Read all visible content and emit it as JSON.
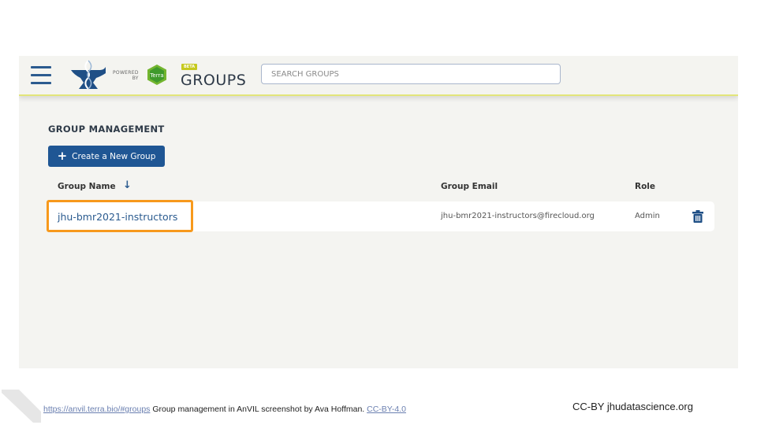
{
  "header": {
    "powered_by_line1": "POWERED",
    "powered_by_line2": "BY",
    "terra_label": "Terra",
    "beta_badge": "BETA",
    "title": "GROUPS",
    "search_placeholder": "SEARCH GROUPS",
    "search_value": ""
  },
  "main": {
    "section_title": "GROUP MANAGEMENT",
    "create_button_label": "Create a New Group",
    "columns": {
      "name": "Group Name",
      "email": "Group Email",
      "role": "Role"
    },
    "sort_direction": "descending",
    "rows": [
      {
        "name": "jhu-bmr2021-instructors",
        "email": "jhu-bmr2021-instructors@firecloud.org",
        "role": "Admin"
      }
    ]
  },
  "footer": {
    "link_url_text": "https://anvil.terra.bio/#groups",
    "caption": " Group management in AnVIL screenshot by Ava Hoffman. ",
    "license_link": "CC-BY-4.0",
    "right_text": "CC-BY  jhudatascience.org"
  },
  "colors": {
    "accent_blue": "#1f5694",
    "highlight_orange": "#f7991c",
    "header_underline": "#e2e57a",
    "beta_badge": "#c6c91f",
    "terra_green": "#73b52f"
  }
}
